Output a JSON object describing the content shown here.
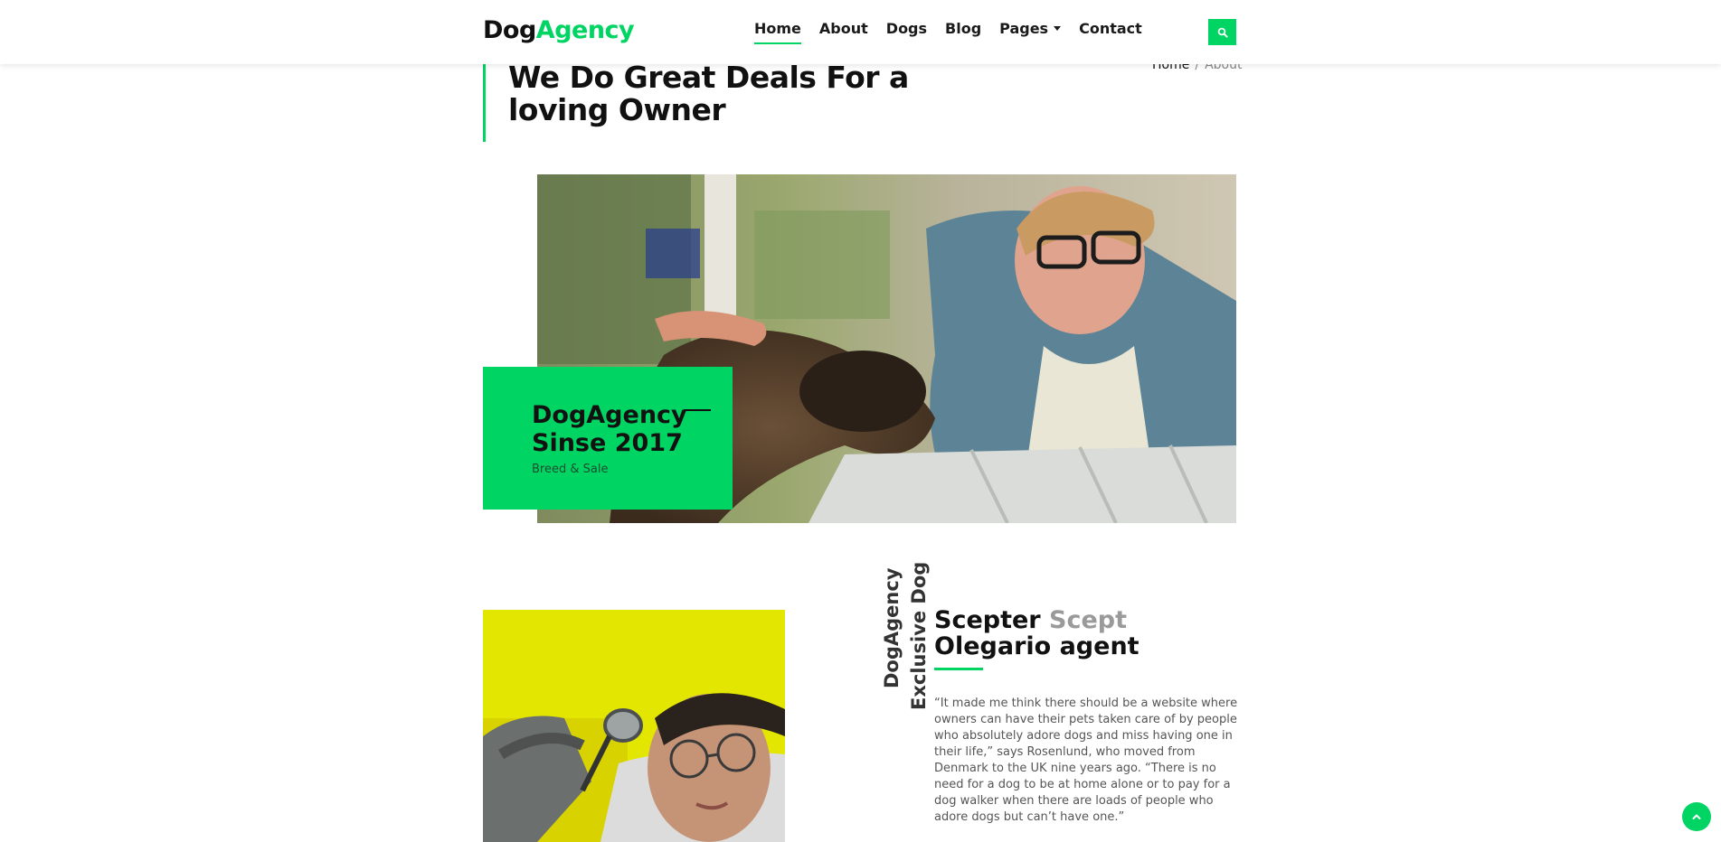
{
  "brand": {
    "part1": "Dog",
    "part2": "Agency"
  },
  "nav": {
    "items": [
      {
        "label": "Home",
        "active": true
      },
      {
        "label": "About"
      },
      {
        "label": "Dogs"
      },
      {
        "label": "Blog"
      },
      {
        "label": "Pages",
        "dropdown": true
      },
      {
        "label": "Contact"
      }
    ]
  },
  "search": {
    "icon": "search-icon"
  },
  "hero": {
    "title": "We Do Great Deals For a loving Owner"
  },
  "breadcrumb": {
    "home": "Home",
    "separator": "/",
    "current": "About"
  },
  "since": {
    "title": "DogAgency\nSinse 2017",
    "subtitle": "Breed & Sale"
  },
  "agent": {
    "vertical_line1": "DogAgency",
    "vertical_line2": "Exclusive Dog",
    "title_part1": "Scepter",
    "title_part2": "Scept",
    "title_part3": "Olegario agent",
    "quote": "“It made me think there should be a website where owners can have their pets taken care of by people who absolutely adore dogs and miss having one in their life,” says Rosenlund, who moved from Denmark to the UK nine years ago. “There is no need for a dog to be at home alone or to pay for a dog walker when there are loads of people who adore dogs but can’t have one.”"
  },
  "colors": {
    "accent": "#00d563",
    "text": "#111111",
    "muted": "#888888"
  },
  "icons": {
    "scroll_top": "chevron-up-icon"
  }
}
